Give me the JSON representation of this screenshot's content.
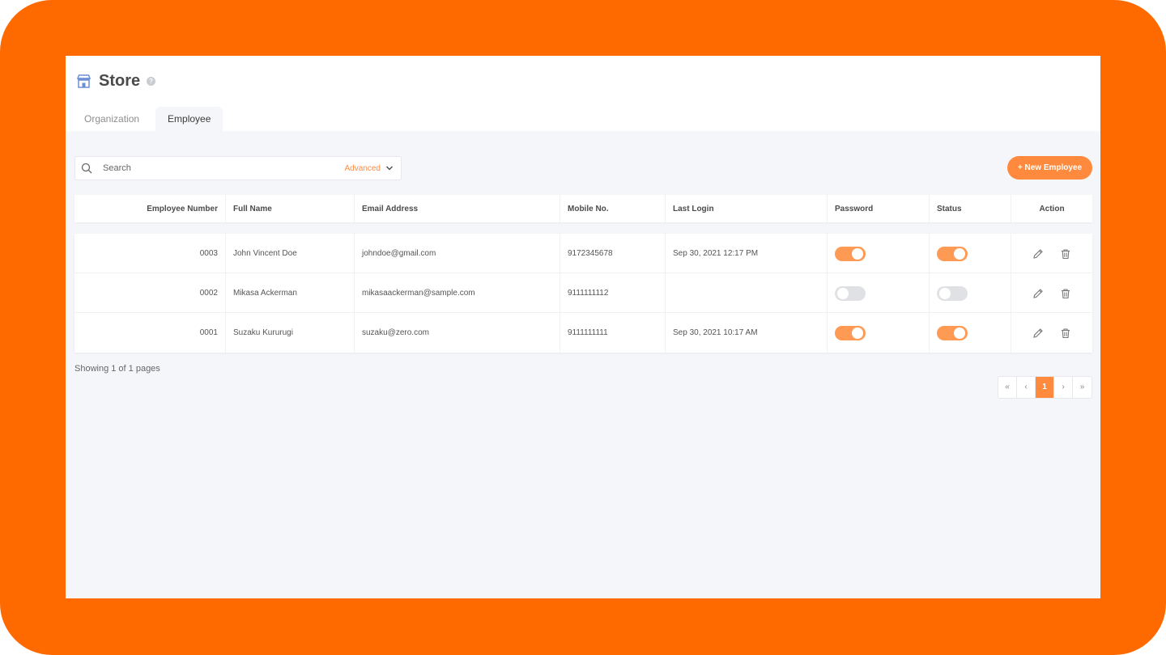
{
  "header": {
    "title": "Store",
    "help": "?"
  },
  "tabs": [
    {
      "label": "Organization",
      "active": false
    },
    {
      "label": "Employee",
      "active": true
    }
  ],
  "search": {
    "placeholder": "Search",
    "value": "",
    "advanced_label": "Advanced"
  },
  "toolbar": {
    "new_label": "+ New Employee"
  },
  "table": {
    "columns": [
      "Employee Number",
      "Full Name",
      "Email Address",
      "Mobile No.",
      "Last Login",
      "Password",
      "Status",
      "Action"
    ],
    "rows": [
      {
        "number": "0003",
        "name": "John Vincent Doe",
        "email": "johndoe@gmail.com",
        "mobile": "9172345678",
        "last_login": "Sep 30, 2021 12:17 PM",
        "password_on": true,
        "status_on": true
      },
      {
        "number": "0002",
        "name": "Mikasa Ackerman",
        "email": "mikasaackerman@sample.com",
        "mobile": "9111111112",
        "last_login": "",
        "password_on": false,
        "status_on": false
      },
      {
        "number": "0001",
        "name": "Suzaku Kururugi",
        "email": "suzaku@zero.com",
        "mobile": "9111111111",
        "last_login": "Sep 30, 2021 10:17 AM",
        "password_on": true,
        "status_on": true
      }
    ]
  },
  "footer": {
    "showing": "Showing 1 of 1 pages"
  },
  "pagination": {
    "first": "«",
    "prev": "‹",
    "current": "1",
    "next": "›",
    "last": "»"
  },
  "colors": {
    "frame": "#ff6a00",
    "accent": "#ff8a3d",
    "toggle_on": "#ff9a55",
    "toggle_off": "#dfe1e5",
    "icon_blue": "#6d8fd6"
  },
  "icons": {
    "store": "store-icon",
    "search": "search-icon",
    "chevron": "chevron-down-icon",
    "edit": "pencil-icon",
    "delete": "trash-icon"
  }
}
